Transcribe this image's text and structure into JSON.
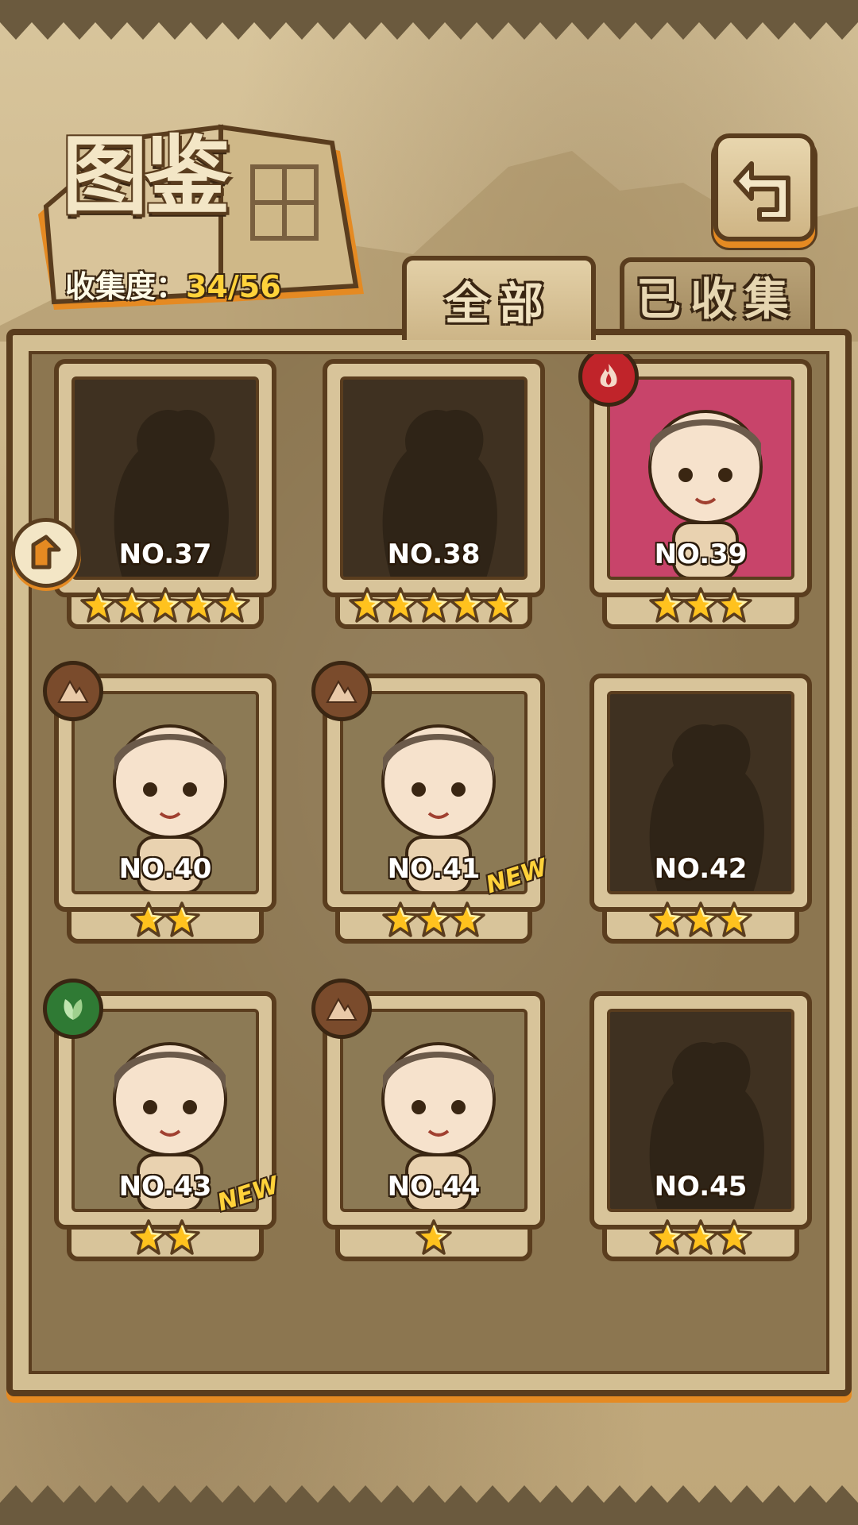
{
  "header": {
    "title": "图鉴",
    "progress_label": "收集度：",
    "progress_value": "34/56"
  },
  "tabs": [
    {
      "label": "全部",
      "active": true
    },
    {
      "label": "已收集",
      "active": false
    }
  ],
  "icons": {
    "back": "back-arrow-icon",
    "side": "side-arrow-icon",
    "fire": "fire-element-icon",
    "earth": "earth-element-icon",
    "grass": "grass-element-icon"
  },
  "colors": {
    "accent_orange": "#e58a22",
    "frame_brown": "#5a3d1e",
    "star_gold": "#ffc21e",
    "fire": "#c0242a",
    "earth": "#7a4b2c",
    "grass": "#2f7a34"
  },
  "cards": [
    {
      "no": "NO.37",
      "stars": 5,
      "locked": true,
      "element": null,
      "new": false
    },
    {
      "no": "NO.38",
      "stars": 5,
      "locked": true,
      "element": null,
      "new": false
    },
    {
      "no": "NO.39",
      "stars": 3,
      "locked": false,
      "element": "fire",
      "new": false
    },
    {
      "no": "NO.40",
      "stars": 2,
      "locked": false,
      "element": "earth",
      "new": false
    },
    {
      "no": "NO.41",
      "stars": 3,
      "locked": false,
      "element": "earth",
      "new": true
    },
    {
      "no": "NO.42",
      "stars": 3,
      "locked": true,
      "element": null,
      "new": false
    },
    {
      "no": "NO.43",
      "stars": 2,
      "locked": false,
      "element": "grass",
      "new": true
    },
    {
      "no": "NO.44",
      "stars": 1,
      "locked": false,
      "element": "earth",
      "new": false
    },
    {
      "no": "NO.45",
      "stars": 3,
      "locked": true,
      "element": null,
      "new": false
    }
  ],
  "new_label": "NEW"
}
